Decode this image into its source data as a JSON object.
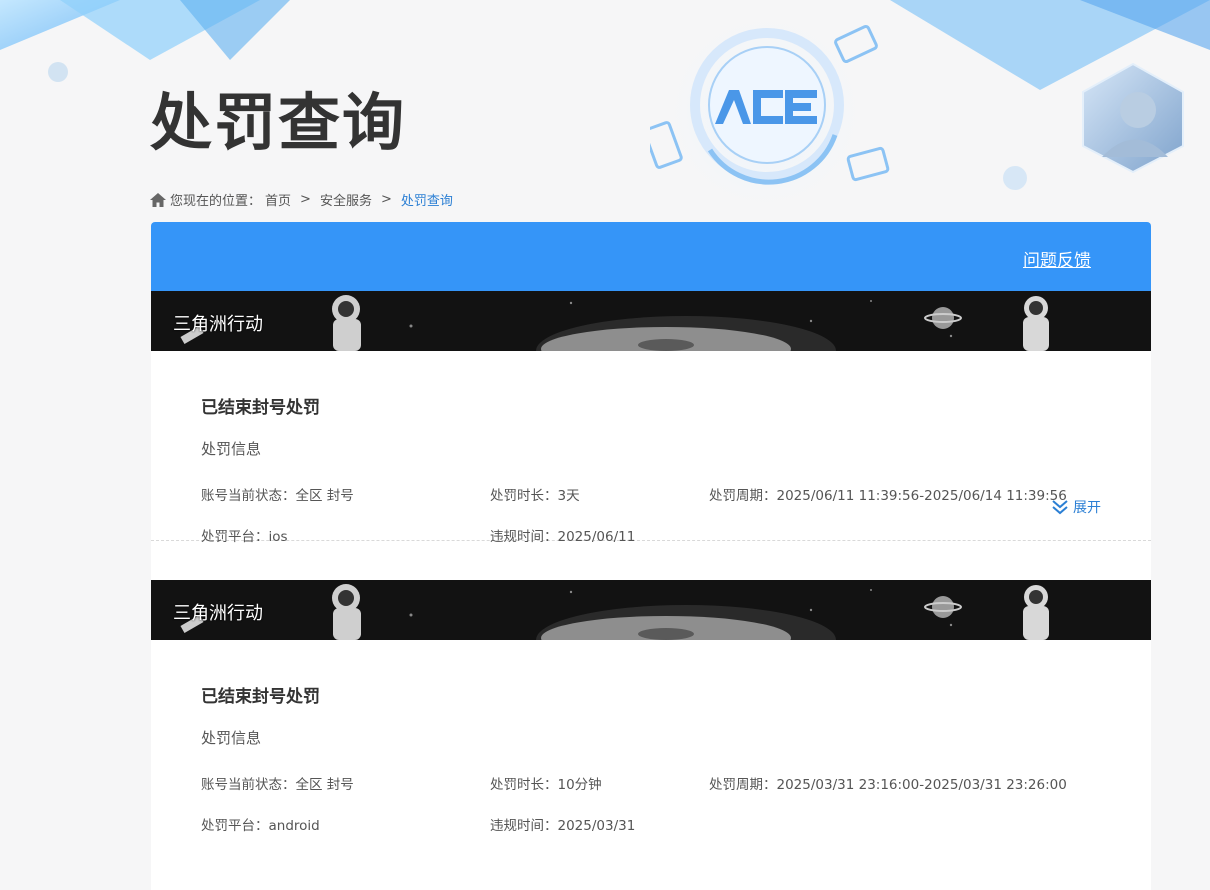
{
  "page": {
    "title": "处罚查询"
  },
  "breadcrumb": {
    "prefix": "您现在的位置：",
    "items": [
      "首页",
      "安全服务"
    ],
    "current": "处罚查询"
  },
  "header": {
    "feedback_label": "问题反馈"
  },
  "records": [
    {
      "game": "三角洲行动",
      "title": "已结束封号处罚",
      "subtitle": "处罚信息",
      "status": "账号当前状态：全区 封号",
      "duration": "处罚时长：3天",
      "period": "处罚周期：2025/06/11 11:39:56-2025/06/14 11:39:56",
      "platform": "处罚平台：ios",
      "violation_time": "违规时间：2025/06/11",
      "expand_label": "展开"
    },
    {
      "game": "三角洲行动",
      "title": "已结束封号处罚",
      "subtitle": "处罚信息",
      "status": "账号当前状态：全区 封号",
      "duration": "处罚时长：10分钟",
      "period": "处罚周期：2025/03/31 23:16:00-2025/03/31 23:26:00",
      "platform": "处罚平台：android",
      "violation_time": "违规时间：2025/03/31"
    }
  ],
  "colors": {
    "accent": "#3595f8",
    "link": "#2b7fd4",
    "banner": "#121212"
  },
  "logo": "ACE"
}
